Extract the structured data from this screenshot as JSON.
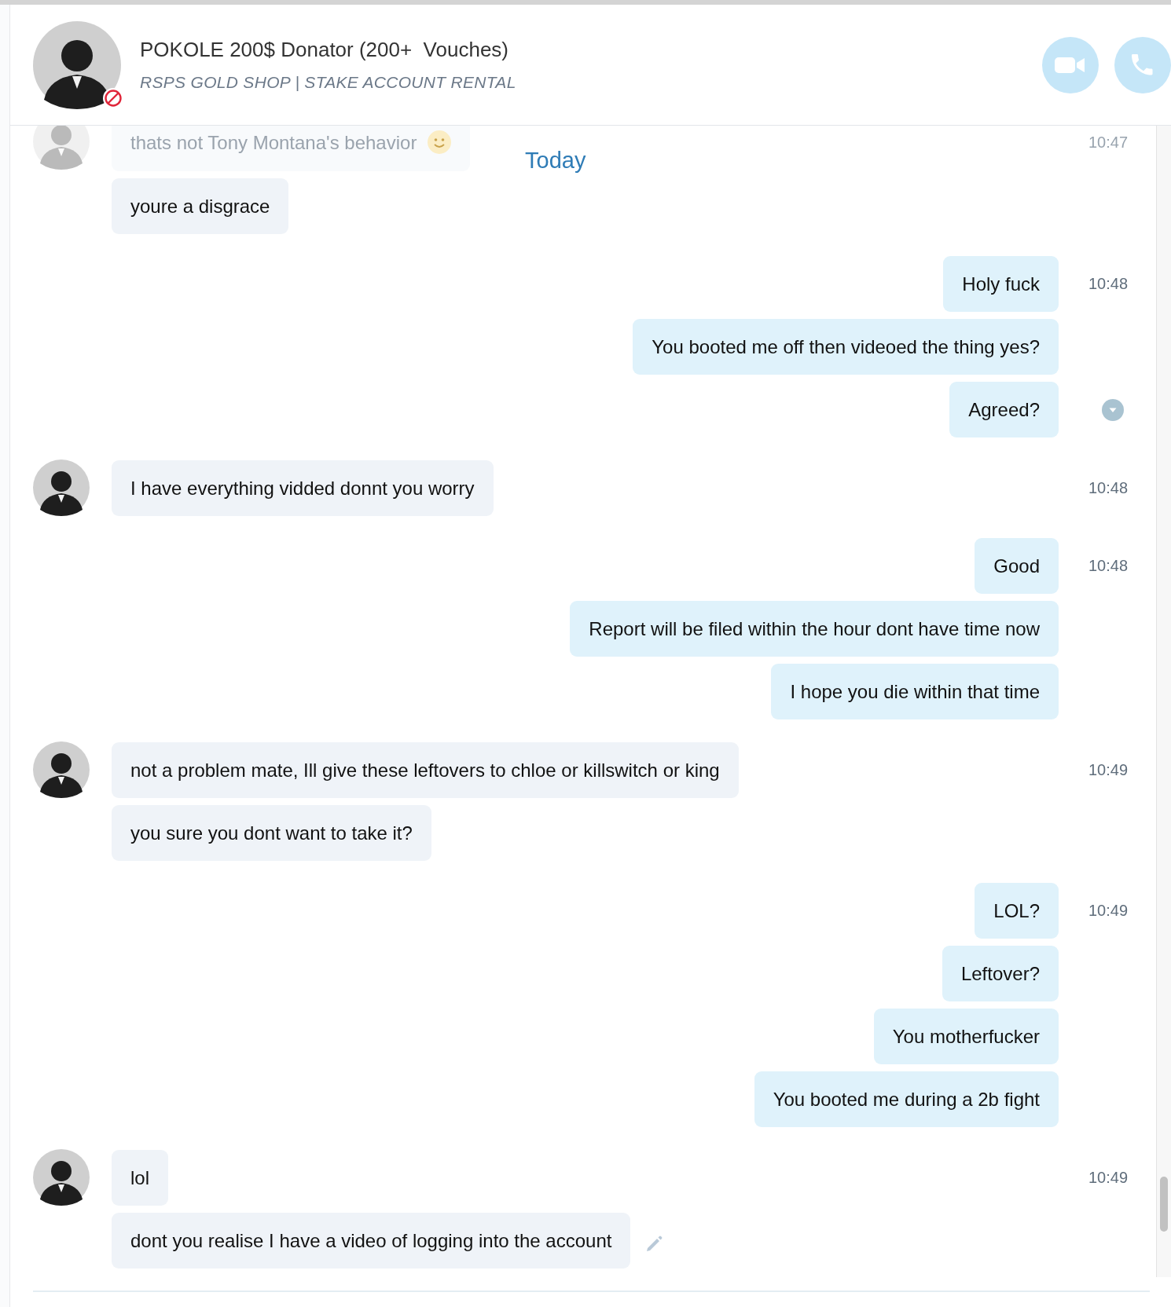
{
  "header": {
    "name": "POKOLE 200$ Donator (200+  Vouches)",
    "subtitle": "RSPS GOLD SHOP | STAKE ACCOUNT RENTAL",
    "blocked": true
  },
  "date_divider": "Today",
  "groups": [
    {
      "kind": "incoming",
      "time": "10:47",
      "messages": [
        {
          "text": "thats not Tony Montana's behavior",
          "emoji": true,
          "dimmed": true,
          "hovered": false,
          "edited": false
        },
        {
          "text": "youre a disgrace",
          "emoji": false,
          "dimmed": false,
          "hovered": false,
          "edited": false
        }
      ]
    },
    {
      "kind": "outgoing",
      "time": "10:48",
      "messages": [
        {
          "text": "Holy fuck",
          "emoji": false,
          "dimmed": false,
          "hovered": false,
          "edited": false
        },
        {
          "text": "You booted me off then videoed the thing yes?",
          "emoji": false,
          "dimmed": false,
          "hovered": false,
          "edited": false
        },
        {
          "text": "Agreed?",
          "emoji": false,
          "dimmed": false,
          "hovered": true,
          "edited": false
        }
      ]
    },
    {
      "kind": "incoming",
      "time": "10:48",
      "messages": [
        {
          "text": "I have everything vidded donnt you worry",
          "emoji": false,
          "dimmed": false,
          "hovered": false,
          "edited": false
        }
      ]
    },
    {
      "kind": "outgoing",
      "time": "10:48",
      "messages": [
        {
          "text": "Good",
          "emoji": false,
          "dimmed": false,
          "hovered": false,
          "edited": false
        },
        {
          "text": "Report will be filed within the hour dont have time now",
          "emoji": false,
          "dimmed": false,
          "hovered": false,
          "edited": false
        },
        {
          "text": "I hope you die within that time",
          "emoji": false,
          "dimmed": false,
          "hovered": false,
          "edited": false
        }
      ]
    },
    {
      "kind": "incoming",
      "time": "10:49",
      "messages": [
        {
          "text": "not a problem mate, Ill give these leftovers to chloe or killswitch or king",
          "emoji": false,
          "dimmed": false,
          "hovered": false,
          "edited": false
        },
        {
          "text": "you sure you dont want to take it?",
          "emoji": false,
          "dimmed": false,
          "hovered": false,
          "edited": false
        }
      ]
    },
    {
      "kind": "outgoing",
      "time": "10:49",
      "messages": [
        {
          "text": "LOL?",
          "emoji": false,
          "dimmed": false,
          "hovered": false,
          "edited": false
        },
        {
          "text": "Leftover?",
          "emoji": false,
          "dimmed": false,
          "hovered": false,
          "edited": false
        },
        {
          "text": "You motherfucker",
          "emoji": false,
          "dimmed": false,
          "hovered": false,
          "edited": false
        },
        {
          "text": "You booted me during a 2b fight",
          "emoji": false,
          "dimmed": false,
          "hovered": false,
          "edited": false
        }
      ]
    },
    {
      "kind": "incoming",
      "time": "10:49",
      "messages": [
        {
          "text": "lol",
          "emoji": false,
          "dimmed": false,
          "hovered": false,
          "edited": false
        },
        {
          "text": "dont you realise I have a video of logging into the account",
          "emoji": false,
          "dimmed": false,
          "hovered": false,
          "edited": true
        }
      ]
    }
  ]
}
